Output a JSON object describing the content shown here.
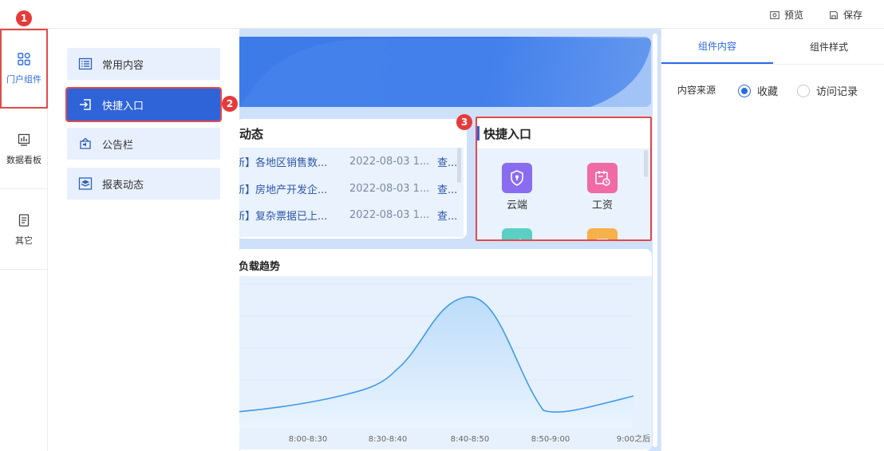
{
  "toolbar": {
    "preview_label": "预览",
    "save_label": "保存"
  },
  "rail": {
    "items": [
      {
        "label": "门户组件",
        "icon": "apps-icon",
        "active": true
      },
      {
        "label": "数据看板",
        "icon": "dashboard-chart-icon",
        "active": false
      },
      {
        "label": "其它",
        "icon": "document-icon",
        "active": false
      }
    ]
  },
  "components": {
    "items": [
      {
        "label": "常用内容",
        "icon": "list-icon"
      },
      {
        "label": "快捷入口",
        "icon": "enter-icon"
      },
      {
        "label": "公告栏",
        "icon": "announcement-icon"
      },
      {
        "label": "报表动态",
        "icon": "layers-icon"
      }
    ]
  },
  "badges": [
    "1",
    "2",
    "3"
  ],
  "news_card": {
    "title": "动态",
    "rows": [
      {
        "title": "新】各地区销售数...",
        "date": "2022-08-03 1...",
        "view": "查..."
      },
      {
        "title": "新】房地产开发企...",
        "date": "2022-08-03 1...",
        "view": "查..."
      },
      {
        "title": "新】复杂票据已上...",
        "date": "2022-08-03 1...",
        "view": "查..."
      }
    ]
  },
  "quick_card": {
    "title": "快捷入口",
    "items": [
      {
        "label": "云端",
        "icon": "cloud-lock-icon",
        "color": "#8a6cf0"
      },
      {
        "label": "工资",
        "icon": "calendar-clock-icon",
        "color": "#f06aa6"
      }
    ]
  },
  "chart_card": {
    "title": "负载趋势"
  },
  "chart_data": {
    "type": "area",
    "categories": [
      "8:00-8:30",
      "8:30-8:40",
      "8:40-8:50",
      "8:50-9:00",
      "9:00之后"
    ],
    "x_labels": [
      "8:00-8:30",
      "8:30-8:40",
      "8:40-8:50",
      "8:50-9:00",
      "9:00之后"
    ],
    "color": "#3f9be8"
  },
  "right_panel": {
    "tabs": [
      {
        "label": "组件内容",
        "active": true
      },
      {
        "label": "组件样式",
        "active": false
      }
    ],
    "source_label": "内容来源",
    "options": [
      {
        "label": "收藏",
        "checked": true
      },
      {
        "label": "访问记录",
        "checked": false
      }
    ]
  }
}
